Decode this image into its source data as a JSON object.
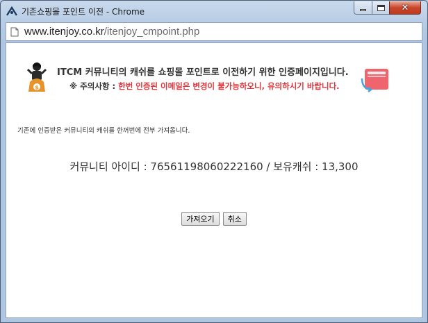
{
  "window": {
    "title": "기존쇼핑몰 포인트 이전 - Chrome",
    "minimize_icon": "minimize-icon",
    "maximize_icon": "maximize-icon",
    "close_icon": "close-icon",
    "close_symbol": "✕"
  },
  "address_bar": {
    "host": "www.itenjoy.co.kr",
    "path": "/itenjoy_cmpoint.php",
    "icon": "page-icon"
  },
  "header": {
    "title": "ITCM 커뮤니티의 캐쉬를 쇼핑몰 포인트로 이전하기 위한 인증페이지입니다.",
    "notice_label": "※ 주의사항 :",
    "notice_text": "한번 인증된 이메일은 변경이 불가능하오니, 유의하시기 바랍니다.",
    "mascot_icon": "mascot-icon",
    "wallet_icon": "wallet-icon"
  },
  "main": {
    "description": "기존에 인증받은 커뮤니티의 캐쉬를 한꺼번에 전부 가져옵니다.",
    "info": "커뮤니티 아이디 : 76561198060222160 / 보유캐쉬 : 13,300"
  },
  "buttons": {
    "fetch_label": "가져오기",
    "cancel_label": "취소"
  },
  "colors": {
    "accent_red": "#e0353b",
    "wallet_pink": "#f0646e"
  }
}
